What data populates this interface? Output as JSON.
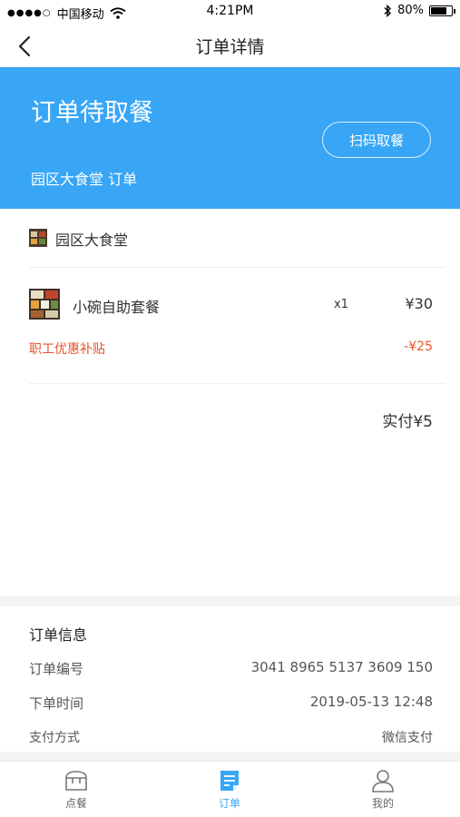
{
  "status_bar": {
    "signal_dots": "●●●●○",
    "carrier": "中国移动",
    "time": "4:21PM",
    "battery": "80%",
    "battery_level": 0.8
  },
  "nav": {
    "title": "订单详情",
    "back_icon": "chevron-left-icon"
  },
  "hero": {
    "status": "订单待取餐",
    "subtitle": "园区大食堂  订单",
    "scan_button": "扫码取餐",
    "background_color": "#38a6f5"
  },
  "store": {
    "name": "园区大食堂"
  },
  "items": [
    {
      "name": "小碗自助套餐",
      "qty": "x1",
      "price": "¥30"
    }
  ],
  "discount": {
    "label": "职工优惠补贴",
    "value": "-¥25",
    "color": "#e4562d"
  },
  "total": {
    "label": "实付¥5"
  },
  "order_info": {
    "title": "订单信息",
    "rows": [
      {
        "label": "订单编号",
        "value": "3041 8965 5137 3609 150"
      },
      {
        "label": "下单时间",
        "value": "2019-05-13 12:48"
      },
      {
        "label": "支付方式",
        "value": "微信支付"
      }
    ]
  },
  "tabs": [
    {
      "label": "点餐",
      "icon": "store-icon",
      "active": false
    },
    {
      "label": "订单",
      "icon": "order-icon",
      "active": true
    },
    {
      "label": "我的",
      "icon": "user-icon",
      "active": false
    }
  ]
}
